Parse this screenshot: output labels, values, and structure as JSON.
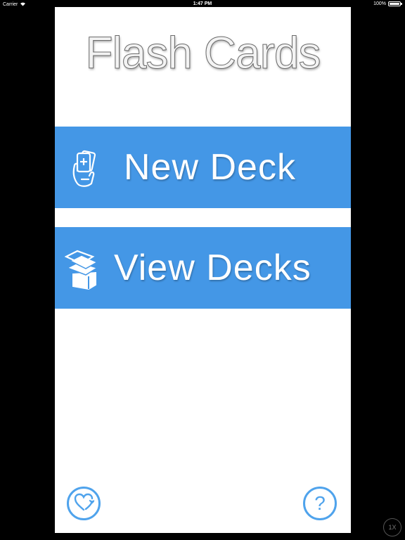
{
  "status_bar": {
    "carrier": "Carrier",
    "wifi_icon": "wifi-icon",
    "time": "1:47 PM",
    "battery_percent": "100%",
    "battery_level": 1.0
  },
  "app": {
    "title": "Flash Cards",
    "new_deck": {
      "label": "New Deck",
      "icon": "new-card-hand-icon"
    },
    "view_decks": {
      "label": "View Decks",
      "icon": "card-stack-icon"
    },
    "favorite_button_icon": "heart-refresh-icon",
    "help_button": {
      "label": "?",
      "icon": "help-icon"
    }
  },
  "simulator": {
    "scale_label": "1X"
  },
  "colors": {
    "accent": "#4497e6",
    "round_button": "#4fa3ec",
    "background": "#000000",
    "surface": "#ffffff"
  }
}
